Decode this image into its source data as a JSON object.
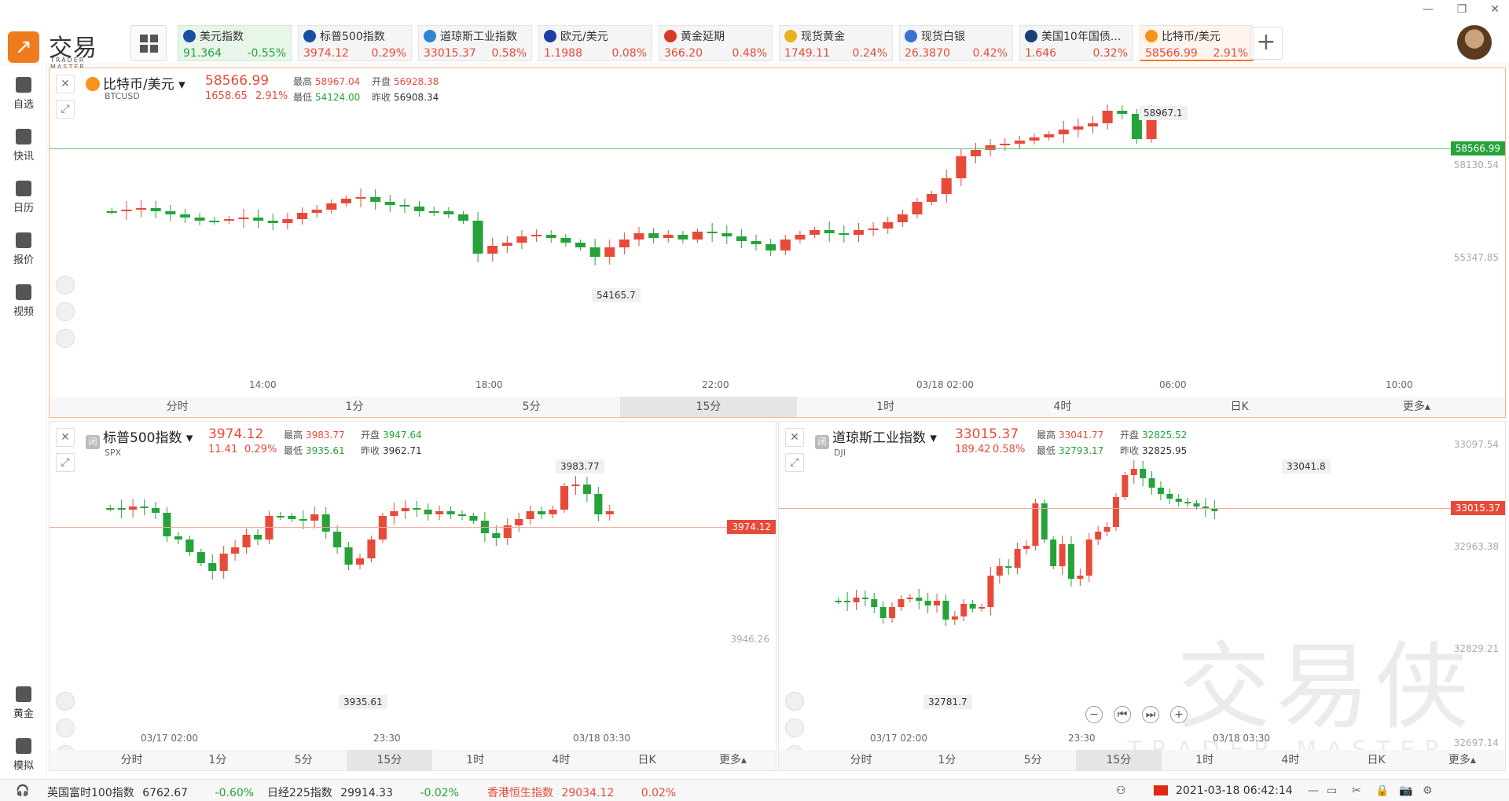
{
  "app": {
    "logo_cn": "交易侠",
    "logo_en": "TRADER MASTER"
  },
  "tickers": [
    {
      "name": "美元指数",
      "price": "91.364",
      "change": "-0.55%",
      "dir": "green",
      "flag": "#1b4fa3"
    },
    {
      "name": "标普500指数",
      "price": "3974.12",
      "change": "0.29%",
      "dir": "red",
      "flag": "#1b4fa3"
    },
    {
      "name": "道琼斯工业指数",
      "price": "33015.37",
      "change": "0.58%",
      "dir": "red",
      "flag": "#2c86d6"
    },
    {
      "name": "欧元/美元",
      "price": "1.1988",
      "change": "0.08%",
      "dir": "red",
      "flag": "#1b3fa3"
    },
    {
      "name": "黄金延期",
      "price": "366.20",
      "change": "0.48%",
      "dir": "red",
      "flag": "#d63a2a"
    },
    {
      "name": "现货黄金",
      "price": "1749.11",
      "change": "0.24%",
      "dir": "red",
      "flag": "#e9b21c"
    },
    {
      "name": "现货白银",
      "price": "26.3870",
      "change": "0.42%",
      "dir": "red",
      "flag": "#3a6fd6"
    },
    {
      "name": "美国10年国债...",
      "price": "1.646",
      "change": "0.32%",
      "dir": "red",
      "flag": "#1b3f7a"
    },
    {
      "name": "比特币/美元",
      "price": "58566.99",
      "change": "2.91%",
      "dir": "red",
      "flag": "#f7931a"
    }
  ],
  "sidebar": {
    "items": [
      {
        "label": "自选",
        "icon": "bookmark-add-icon"
      },
      {
        "label": "快讯",
        "icon": "news-icon"
      },
      {
        "label": "日历",
        "icon": "calendar-icon"
      },
      {
        "label": "报价",
        "icon": "chart-line-icon"
      },
      {
        "label": "视频",
        "icon": "video-icon"
      }
    ],
    "bottom": [
      {
        "label": "黄金",
        "icon": "gold-icon"
      },
      {
        "label": "模拟",
        "icon": "simulate-icon"
      }
    ]
  },
  "labels": {
    "high": "最高",
    "low": "最低",
    "open": "开盘",
    "prev": "昨收",
    "closed": "闭",
    "more": "更多▴"
  },
  "timeframes": [
    "分时",
    "1分",
    "5分",
    "15分",
    "1时",
    "4时",
    "日K",
    "更多▴"
  ],
  "panels": {
    "btc": {
      "name": "比特币/美元",
      "code": "BTCUSD",
      "price": "58566.99",
      "chg": "1658.65",
      "pct": "2.91%",
      "high": "58967.04",
      "open": "56928.38",
      "low": "54124.00",
      "prev": "56908.34",
      "max_label": "58967.1",
      "min_label": "54165.7",
      "yticks": [
        "58130.54",
        "55347.85"
      ],
      "price_tag": "58566.99",
      "xticks": [
        "14:00",
        "18:00",
        "22:00",
        "03/18 02:00",
        "06:00",
        "10:00"
      ]
    },
    "spx": {
      "name": "标普500指数",
      "code": "SPX",
      "price": "3974.12",
      "chg": "11.41",
      "pct": "0.29%",
      "high": "3983.77",
      "open": "3947.64",
      "low": "3935.61",
      "prev": "3962.71",
      "max_label": "3983.77",
      "min_label": "3935.61",
      "yticks": [
        "3946.26"
      ],
      "price_tag": "3974.12",
      "xticks": [
        "03/17 02:00",
        "23:30",
        "03/18 03:30"
      ]
    },
    "dji": {
      "name": "道琼斯工业指数",
      "code": "DJI",
      "price": "33015.37",
      "chg": "189.42",
      "pct": "0.58%",
      "high": "33041.77",
      "open": "32825.52",
      "low": "32793.17",
      "prev": "32825.95",
      "max_label": "33041.8",
      "min_label": "32781.7",
      "yticks": [
        "33097.54",
        "32963.38",
        "32829.21",
        "32697.14"
      ],
      "price_tag": "33015.37",
      "xticks": [
        "03/17 02:00",
        "23:30",
        "03/18 03:30"
      ]
    }
  },
  "status": {
    "items": [
      {
        "name": "英国富时100指数",
        "value": "6762.67",
        "pct": "-0.60%",
        "dir": "green"
      },
      {
        "name": "日经225指数",
        "value": "29914.33",
        "pct": "-0.02%",
        "dir": "green"
      },
      {
        "name": "香港恒生指数",
        "value": "29034.12",
        "pct": "0.02%",
        "dir": "red"
      }
    ],
    "datetime": "2021-03-18 06:42:14"
  }
}
